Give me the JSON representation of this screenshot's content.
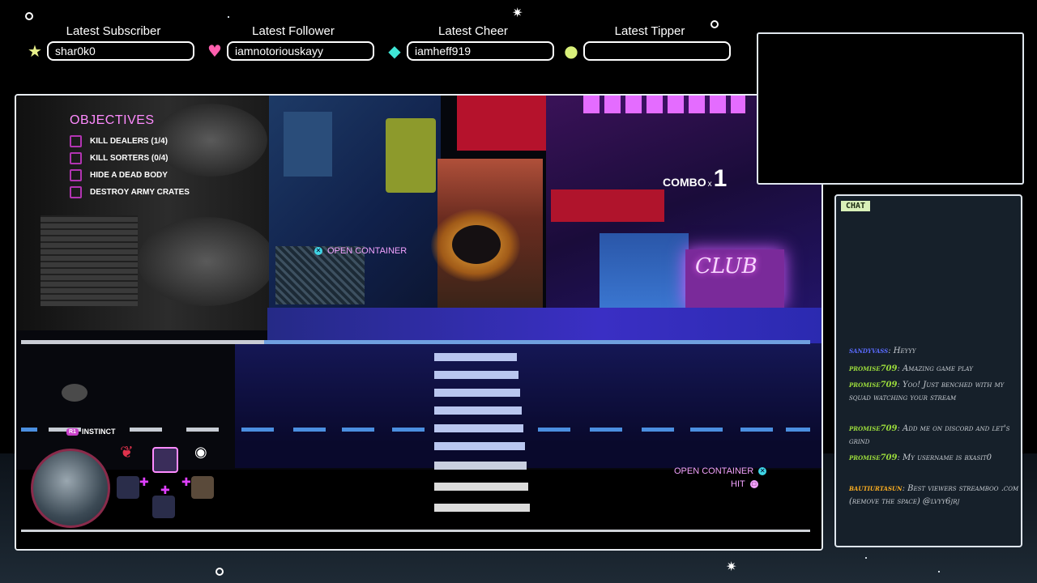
{
  "alerts": [
    {
      "title": "Latest Subscriber",
      "value": "shar0k0",
      "icon": "star-icon",
      "color": "#e8f08a"
    },
    {
      "title": "Latest Follower",
      "value": "iamnotoriouskayy",
      "icon": "heart-icon",
      "color": "#ff5fae"
    },
    {
      "title": "Latest Cheer",
      "value": "iamheff919",
      "icon": "gem-icon",
      "color": "#3fe6d6"
    },
    {
      "title": "Latest Tipper",
      "value": "",
      "icon": "coin-icon",
      "color": "#d9f07a"
    }
  ],
  "game": {
    "objectives_title": "OBJECTIVES",
    "objectives": [
      "KILL DEALERS (1/4)",
      "KILL SORTERS (0/4)",
      "HIDE A DEAD BODY",
      "DESTROY ARMY CRATES"
    ],
    "combo_label": "COMBO",
    "combo_x": "x",
    "combo_count": "1",
    "open_container_world": "OPEN CONTAINER",
    "open_container_hud": "OPEN CONTAINER",
    "hit_label": "HIT",
    "instinct_button": "R1",
    "instinct_label": "INSTINCT",
    "neon_sign": "CLUB"
  },
  "chat": {
    "title": "CHAT",
    "messages": [
      {
        "user": "sandyvass",
        "text": "Heyyy",
        "color": "#5a6bff"
      },
      {
        "user": "promise709",
        "text": "Amazing game play",
        "color": "#9cdc3c"
      },
      {
        "user": "promise709",
        "text": "Yoo! Just benched with my squad watching your stream",
        "color": "#9cdc3c"
      },
      {
        "user": "promise709",
        "text": "Add me on discord and let's grind",
        "color": "#9cdc3c"
      },
      {
        "user": "promise709",
        "text": "My username is bxasit0",
        "color": "#9cdc3c"
      },
      {
        "user": "bautiurtasun",
        "text": "Best viewers streamboo .com (remove the space) @lvyy6jrj",
        "color": "#ffb020"
      }
    ]
  }
}
